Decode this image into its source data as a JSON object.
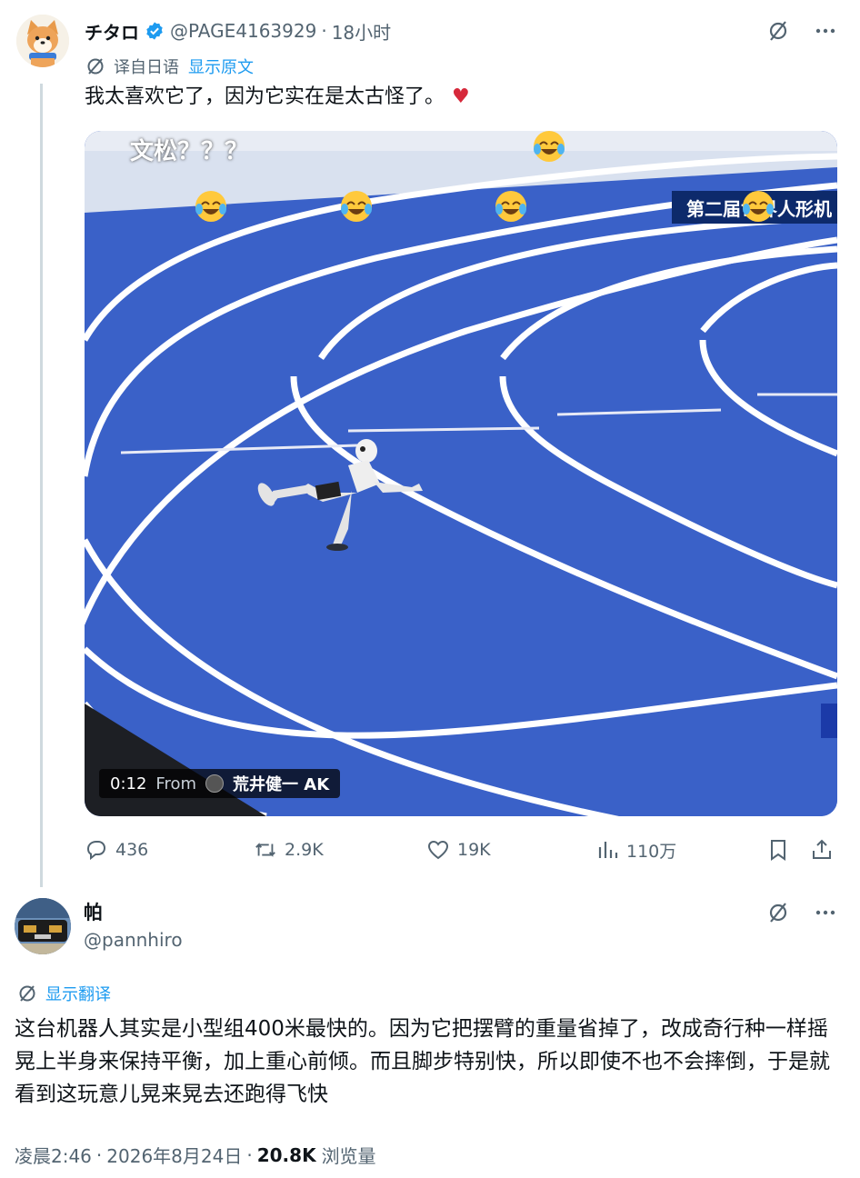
{
  "tweet": {
    "author_name": "チタロ",
    "author_handle": "@PAGE4163929",
    "separator": "·",
    "time": "18小时",
    "translated_from": "译自日语",
    "show_original": "显示原文",
    "text": "我太喜欢它了，因为它实在是太古怪了。",
    "heart_emoji": "♥",
    "video": {
      "overlay_caption": "文松？？？",
      "overlay_corner": "第二届世界人形机",
      "timestamp": "0:12",
      "from_label": "From",
      "source_name": "荒井健一 AK"
    },
    "actions": {
      "replies": "436",
      "reposts": "2.9K",
      "likes": "19K",
      "views": "110万"
    }
  },
  "reply": {
    "author_name": "帕",
    "author_handle": "@pannhiro",
    "show_translation": "显示翻译",
    "text": "这台机器人其实是小型组400米最快的。因为它把摆臂的重量省掉了，改成奇行种一样摇晃上半身来保持平衡，加上重心前倾。而且脚步特别快，所以即使不也不会摔倒，于是就看到这玩意儿晃来晃去还跑得飞快",
    "time": "凌晨2:46",
    "date": "2026年8月24日",
    "separator": "·",
    "views_count": "20.8K",
    "views_label": "浏览量"
  },
  "colors": {
    "accent": "#1d9bf0",
    "secondary_text": "#536471",
    "track_blue": "#2d55b9",
    "heart_red": "#d6293b"
  }
}
